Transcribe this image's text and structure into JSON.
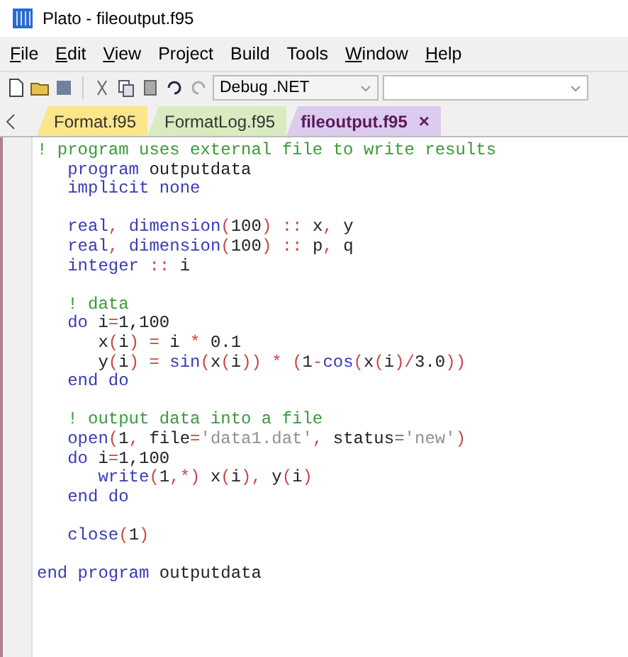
{
  "window": {
    "title": "Plato - fileoutput.f95"
  },
  "menu": [
    {
      "label": "File",
      "mnemonic": true
    },
    {
      "label": "Edit",
      "mnemonic": true
    },
    {
      "label": "View",
      "mnemonic": true
    },
    {
      "label": "Project",
      "mnemonic": false
    },
    {
      "label": "Build",
      "mnemonic": false
    },
    {
      "label": "Tools",
      "mnemonic": false
    },
    {
      "label": "Window",
      "mnemonic": true
    },
    {
      "label": "Help",
      "mnemonic": true
    }
  ],
  "toolbar": {
    "configuration": "Debug .NET"
  },
  "tabs": [
    {
      "label": "Format.f95",
      "selected": false,
      "color": "#fbe68a"
    },
    {
      "label": "FormatLog.f95",
      "selected": false,
      "color": "#d9ecc0"
    },
    {
      "label": "fileoutput.f95",
      "selected": true,
      "color": "#dccbee",
      "close": "×"
    }
  ],
  "code": [
    {
      "kind": "code",
      "tokens": [
        {
          "kind": "comment",
          "text": "! program uses external file to write results"
        }
      ]
    },
    {
      "kind": "code",
      "tokens": [
        {
          "kind": "keyword",
          "text": "   program"
        },
        {
          "kind": "name",
          "text": " outputdata"
        }
      ]
    },
    {
      "kind": "code",
      "tokens": [
        {
          "kind": "keyword",
          "text": "   implicit none"
        }
      ]
    },
    {
      "kind": "blank"
    },
    {
      "kind": "code",
      "tokens": [
        {
          "kind": "keyword",
          "text": "   real"
        },
        {
          "kind": "punct",
          "text": ", "
        },
        {
          "kind": "keyword",
          "text": "dimension"
        },
        {
          "kind": "punct",
          "text": "("
        },
        {
          "kind": "name",
          "text": "100"
        },
        {
          "kind": "punct",
          "text": ") :: "
        },
        {
          "kind": "name",
          "text": "x"
        },
        {
          "kind": "punct",
          "text": ", "
        },
        {
          "kind": "name",
          "text": "y"
        }
      ]
    },
    {
      "kind": "code",
      "tokens": [
        {
          "kind": "keyword",
          "text": "   real"
        },
        {
          "kind": "punct",
          "text": ", "
        },
        {
          "kind": "keyword",
          "text": "dimension"
        },
        {
          "kind": "punct",
          "text": "("
        },
        {
          "kind": "name",
          "text": "100"
        },
        {
          "kind": "punct",
          "text": ") :: "
        },
        {
          "kind": "name",
          "text": "p"
        },
        {
          "kind": "punct",
          "text": ", "
        },
        {
          "kind": "name",
          "text": "q"
        }
      ]
    },
    {
      "kind": "code",
      "tokens": [
        {
          "kind": "keyword",
          "text": "   integer"
        },
        {
          "kind": "punct",
          "text": " :: "
        },
        {
          "kind": "name",
          "text": "i"
        }
      ]
    },
    {
      "kind": "blank"
    },
    {
      "kind": "code",
      "tokens": [
        {
          "kind": "comment",
          "text": "   ! data"
        }
      ]
    },
    {
      "kind": "code",
      "tokens": [
        {
          "kind": "keyword",
          "text": "   do"
        },
        {
          "kind": "name",
          "text": " i"
        },
        {
          "kind": "punct",
          "text": "="
        },
        {
          "kind": "name",
          "text": "1,100"
        }
      ]
    },
    {
      "kind": "code",
      "tokens": [
        {
          "kind": "name",
          "text": "      x"
        },
        {
          "kind": "punct",
          "text": "("
        },
        {
          "kind": "name",
          "text": "i"
        },
        {
          "kind": "punct",
          "text": ") = "
        },
        {
          "kind": "name",
          "text": "i"
        },
        {
          "kind": "punct",
          "text": " * "
        },
        {
          "kind": "name",
          "text": "0.1"
        }
      ]
    },
    {
      "kind": "code",
      "tokens": [
        {
          "kind": "name",
          "text": "      y"
        },
        {
          "kind": "punct",
          "text": "("
        },
        {
          "kind": "name",
          "text": "i"
        },
        {
          "kind": "punct",
          "text": ") = "
        },
        {
          "kind": "keyword",
          "text": "sin"
        },
        {
          "kind": "punct",
          "text": "("
        },
        {
          "kind": "name",
          "text": "x"
        },
        {
          "kind": "punct",
          "text": "("
        },
        {
          "kind": "name",
          "text": "i"
        },
        {
          "kind": "punct",
          "text": ")) * ("
        },
        {
          "kind": "name",
          "text": "1"
        },
        {
          "kind": "punct",
          "text": "-"
        },
        {
          "kind": "keyword",
          "text": "cos"
        },
        {
          "kind": "punct",
          "text": "("
        },
        {
          "kind": "name",
          "text": "x"
        },
        {
          "kind": "punct",
          "text": "("
        },
        {
          "kind": "name",
          "text": "i"
        },
        {
          "kind": "punct",
          "text": ")/"
        },
        {
          "kind": "name",
          "text": "3.0"
        },
        {
          "kind": "punct",
          "text": "))"
        }
      ]
    },
    {
      "kind": "code",
      "tokens": [
        {
          "kind": "keyword",
          "text": "   end do"
        }
      ]
    },
    {
      "kind": "blank"
    },
    {
      "kind": "code",
      "tokens": [
        {
          "kind": "comment",
          "text": "   ! output data into a file"
        }
      ]
    },
    {
      "kind": "code",
      "tokens": [
        {
          "kind": "keyword",
          "text": "   open"
        },
        {
          "kind": "punct",
          "text": "("
        },
        {
          "kind": "name",
          "text": "1"
        },
        {
          "kind": "punct",
          "text": ", "
        },
        {
          "kind": "name",
          "text": "file"
        },
        {
          "kind": "punct",
          "text": "="
        },
        {
          "kind": "string",
          "text": "'data1.dat'"
        },
        {
          "kind": "punct",
          "text": ", "
        },
        {
          "kind": "name",
          "text": "status"
        },
        {
          "kind": "punct",
          "text": "="
        },
        {
          "kind": "string",
          "text": "'new'"
        },
        {
          "kind": "punct",
          "text": ")"
        }
      ]
    },
    {
      "kind": "code",
      "tokens": [
        {
          "kind": "keyword",
          "text": "   do"
        },
        {
          "kind": "name",
          "text": " i"
        },
        {
          "kind": "punct",
          "text": "="
        },
        {
          "kind": "name",
          "text": "1,100"
        }
      ]
    },
    {
      "kind": "code",
      "tokens": [
        {
          "kind": "keyword",
          "text": "      write"
        },
        {
          "kind": "punct",
          "text": "("
        },
        {
          "kind": "name",
          "text": "1"
        },
        {
          "kind": "punct",
          "text": ",*) "
        },
        {
          "kind": "name",
          "text": "x"
        },
        {
          "kind": "punct",
          "text": "("
        },
        {
          "kind": "name",
          "text": "i"
        },
        {
          "kind": "punct",
          "text": "), "
        },
        {
          "kind": "name",
          "text": "y"
        },
        {
          "kind": "punct",
          "text": "("
        },
        {
          "kind": "name",
          "text": "i"
        },
        {
          "kind": "punct",
          "text": ")"
        }
      ]
    },
    {
      "kind": "code",
      "tokens": [
        {
          "kind": "keyword",
          "text": "   end do"
        }
      ]
    },
    {
      "kind": "blank"
    },
    {
      "kind": "code",
      "tokens": [
        {
          "kind": "keyword",
          "text": "   close"
        },
        {
          "kind": "punct",
          "text": "("
        },
        {
          "kind": "name",
          "text": "1"
        },
        {
          "kind": "punct",
          "text": ")"
        }
      ]
    },
    {
      "kind": "blank"
    },
    {
      "kind": "code",
      "tokens": [
        {
          "kind": "keyword",
          "text": "end program"
        },
        {
          "kind": "name",
          "text": " outputdata"
        }
      ]
    }
  ]
}
